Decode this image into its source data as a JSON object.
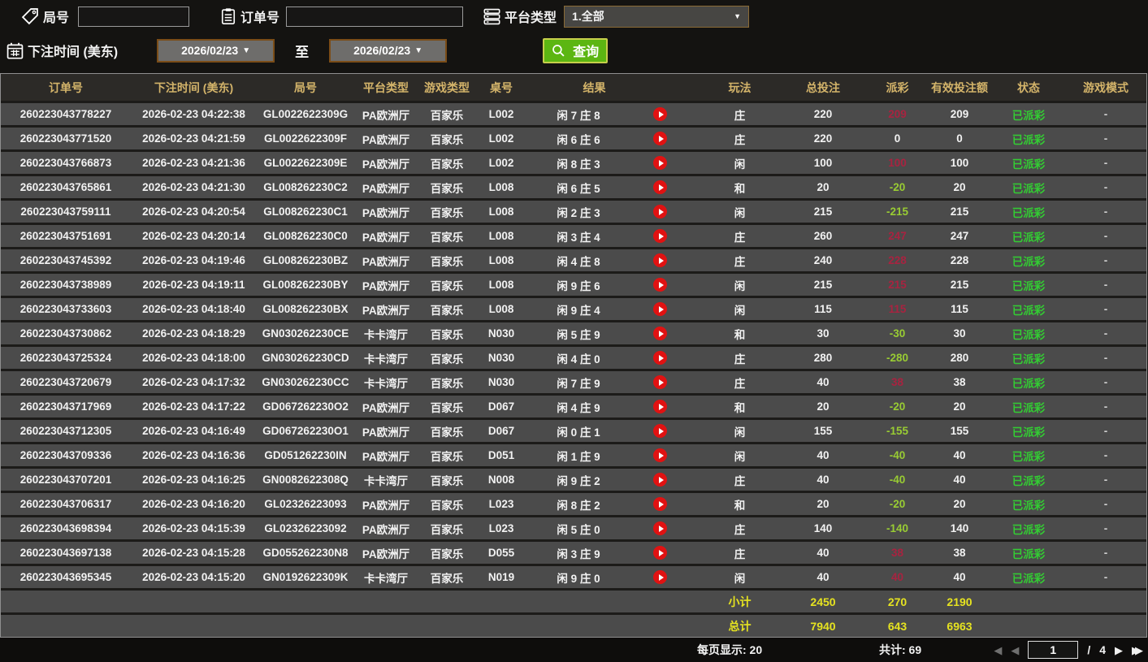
{
  "filters": {
    "round_label": "局号",
    "round_value": "",
    "order_label": "订单号",
    "order_value": "",
    "platform_label": "平台类型",
    "platform_selected": "1.全部",
    "bet_time_label": "下注时间 (美东)",
    "date_from": "2026/02/23",
    "date_to": "2026/02/23",
    "to_label": "至",
    "query_label": "查询"
  },
  "table": {
    "headers": [
      "订单号",
      "下注时间 (美东)",
      "局号",
      "平台类型",
      "游戏类型",
      "桌号",
      "结果",
      "玩法",
      "总投注",
      "派彩",
      "有效投注额",
      "状态",
      "游戏模式"
    ],
    "rows": [
      {
        "order_id": "260223043778227",
        "bet_time": "2026-02-23 04:22:38",
        "round_id": "GL0022622309G",
        "platform": "PA欧洲厅",
        "game_type": "百家乐",
        "table_no": "L002",
        "result": "闲 7 庄 8",
        "play_type": "庄",
        "total_bet": "220",
        "payout": "209",
        "payout_color": "red",
        "valid_bet": "209",
        "status": "已派彩",
        "game_mode": "-"
      },
      {
        "order_id": "260223043771520",
        "bet_time": "2026-02-23 04:21:59",
        "round_id": "GL0022622309F",
        "platform": "PA欧洲厅",
        "game_type": "百家乐",
        "table_no": "L002",
        "result": "闲 6 庄 6",
        "play_type": "庄",
        "total_bet": "220",
        "payout": "0",
        "payout_color": "white",
        "valid_bet": "0",
        "status": "已派彩",
        "game_mode": "-"
      },
      {
        "order_id": "260223043766873",
        "bet_time": "2026-02-23 04:21:36",
        "round_id": "GL0022622309E",
        "platform": "PA欧洲厅",
        "game_type": "百家乐",
        "table_no": "L002",
        "result": "闲 8 庄 3",
        "play_type": "闲",
        "total_bet": "100",
        "payout": "100",
        "payout_color": "red",
        "valid_bet": "100",
        "status": "已派彩",
        "game_mode": "-"
      },
      {
        "order_id": "260223043765861",
        "bet_time": "2026-02-23 04:21:30",
        "round_id": "GL008262230C2",
        "platform": "PA欧洲厅",
        "game_type": "百家乐",
        "table_no": "L008",
        "result": "闲 6 庄 5",
        "play_type": "和",
        "total_bet": "20",
        "payout": "-20",
        "payout_color": "green",
        "valid_bet": "20",
        "status": "已派彩",
        "game_mode": "-"
      },
      {
        "order_id": "260223043759111",
        "bet_time": "2026-02-23 04:20:54",
        "round_id": "GL008262230C1",
        "platform": "PA欧洲厅",
        "game_type": "百家乐",
        "table_no": "L008",
        "result": "闲 2 庄 3",
        "play_type": "闲",
        "total_bet": "215",
        "payout": "-215",
        "payout_color": "green",
        "valid_bet": "215",
        "status": "已派彩",
        "game_mode": "-"
      },
      {
        "order_id": "260223043751691",
        "bet_time": "2026-02-23 04:20:14",
        "round_id": "GL008262230C0",
        "platform": "PA欧洲厅",
        "game_type": "百家乐",
        "table_no": "L008",
        "result": "闲 3 庄 4",
        "play_type": "庄",
        "total_bet": "260",
        "payout": "247",
        "payout_color": "red",
        "valid_bet": "247",
        "status": "已派彩",
        "game_mode": "-"
      },
      {
        "order_id": "260223043745392",
        "bet_time": "2026-02-23 04:19:46",
        "round_id": "GL008262230BZ",
        "platform": "PA欧洲厅",
        "game_type": "百家乐",
        "table_no": "L008",
        "result": "闲 4 庄 8",
        "play_type": "庄",
        "total_bet": "240",
        "payout": "228",
        "payout_color": "red",
        "valid_bet": "228",
        "status": "已派彩",
        "game_mode": "-"
      },
      {
        "order_id": "260223043738989",
        "bet_time": "2026-02-23 04:19:11",
        "round_id": "GL008262230BY",
        "platform": "PA欧洲厅",
        "game_type": "百家乐",
        "table_no": "L008",
        "result": "闲 9 庄 6",
        "play_type": "闲",
        "total_bet": "215",
        "payout": "215",
        "payout_color": "red",
        "valid_bet": "215",
        "status": "已派彩",
        "game_mode": "-"
      },
      {
        "order_id": "260223043733603",
        "bet_time": "2026-02-23 04:18:40",
        "round_id": "GL008262230BX",
        "platform": "PA欧洲厅",
        "game_type": "百家乐",
        "table_no": "L008",
        "result": "闲 9 庄 4",
        "play_type": "闲",
        "total_bet": "115",
        "payout": "115",
        "payout_color": "red",
        "valid_bet": "115",
        "status": "已派彩",
        "game_mode": "-"
      },
      {
        "order_id": "260223043730862",
        "bet_time": "2026-02-23 04:18:29",
        "round_id": "GN030262230CE",
        "platform": "卡卡湾厅",
        "game_type": "百家乐",
        "table_no": "N030",
        "result": "闲 5 庄 9",
        "play_type": "和",
        "total_bet": "30",
        "payout": "-30",
        "payout_color": "green",
        "valid_bet": "30",
        "status": "已派彩",
        "game_mode": "-"
      },
      {
        "order_id": "260223043725324",
        "bet_time": "2026-02-23 04:18:00",
        "round_id": "GN030262230CD",
        "platform": "卡卡湾厅",
        "game_type": "百家乐",
        "table_no": "N030",
        "result": "闲 4 庄 0",
        "play_type": "庄",
        "total_bet": "280",
        "payout": "-280",
        "payout_color": "green",
        "valid_bet": "280",
        "status": "已派彩",
        "game_mode": "-"
      },
      {
        "order_id": "260223043720679",
        "bet_time": "2026-02-23 04:17:32",
        "round_id": "GN030262230CC",
        "platform": "卡卡湾厅",
        "game_type": "百家乐",
        "table_no": "N030",
        "result": "闲 7 庄 9",
        "play_type": "庄",
        "total_bet": "40",
        "payout": "38",
        "payout_color": "red",
        "valid_bet": "38",
        "status": "已派彩",
        "game_mode": "-"
      },
      {
        "order_id": "260223043717969",
        "bet_time": "2026-02-23 04:17:22",
        "round_id": "GD067262230O2",
        "platform": "PA欧洲厅",
        "game_type": "百家乐",
        "table_no": "D067",
        "result": "闲 4 庄 9",
        "play_type": "和",
        "total_bet": "20",
        "payout": "-20",
        "payout_color": "green",
        "valid_bet": "20",
        "status": "已派彩",
        "game_mode": "-"
      },
      {
        "order_id": "260223043712305",
        "bet_time": "2026-02-23 04:16:49",
        "round_id": "GD067262230O1",
        "platform": "PA欧洲厅",
        "game_type": "百家乐",
        "table_no": "D067",
        "result": "闲 0 庄 1",
        "play_type": "闲",
        "total_bet": "155",
        "payout": "-155",
        "payout_color": "green",
        "valid_bet": "155",
        "status": "已派彩",
        "game_mode": "-"
      },
      {
        "order_id": "260223043709336",
        "bet_time": "2026-02-23 04:16:36",
        "round_id": "GD051262230IN",
        "platform": "PA欧洲厅",
        "game_type": "百家乐",
        "table_no": "D051",
        "result": "闲 1 庄 9",
        "play_type": "闲",
        "total_bet": "40",
        "payout": "-40",
        "payout_color": "green",
        "valid_bet": "40",
        "status": "已派彩",
        "game_mode": "-"
      },
      {
        "order_id": "260223043707201",
        "bet_time": "2026-02-23 04:16:25",
        "round_id": "GN0082622308Q",
        "platform": "卡卡湾厅",
        "game_type": "百家乐",
        "table_no": "N008",
        "result": "闲 9 庄 2",
        "play_type": "庄",
        "total_bet": "40",
        "payout": "-40",
        "payout_color": "green",
        "valid_bet": "40",
        "status": "已派彩",
        "game_mode": "-"
      },
      {
        "order_id": "260223043706317",
        "bet_time": "2026-02-23 04:16:20",
        "round_id": "GL02326223093",
        "platform": "PA欧洲厅",
        "game_type": "百家乐",
        "table_no": "L023",
        "result": "闲 8 庄 2",
        "play_type": "和",
        "total_bet": "20",
        "payout": "-20",
        "payout_color": "green",
        "valid_bet": "20",
        "status": "已派彩",
        "game_mode": "-"
      },
      {
        "order_id": "260223043698394",
        "bet_time": "2026-02-23 04:15:39",
        "round_id": "GL02326223092",
        "platform": "PA欧洲厅",
        "game_type": "百家乐",
        "table_no": "L023",
        "result": "闲 5 庄 0",
        "play_type": "庄",
        "total_bet": "140",
        "payout": "-140",
        "payout_color": "green",
        "valid_bet": "140",
        "status": "已派彩",
        "game_mode": "-"
      },
      {
        "order_id": "260223043697138",
        "bet_time": "2026-02-23 04:15:28",
        "round_id": "GD055262230N8",
        "platform": "PA欧洲厅",
        "game_type": "百家乐",
        "table_no": "D055",
        "result": "闲 3 庄 9",
        "play_type": "庄",
        "total_bet": "40",
        "payout": "38",
        "payout_color": "red",
        "valid_bet": "38",
        "status": "已派彩",
        "game_mode": "-"
      },
      {
        "order_id": "260223043695345",
        "bet_time": "2026-02-23 04:15:20",
        "round_id": "GN0192622309K",
        "platform": "卡卡湾厅",
        "game_type": "百家乐",
        "table_no": "N019",
        "result": "闲 9 庄 0",
        "play_type": "闲",
        "total_bet": "40",
        "payout": "40",
        "payout_color": "red",
        "valid_bet": "40",
        "status": "已派彩",
        "game_mode": "-"
      }
    ],
    "subtotal": {
      "label": "小计",
      "total_bet": "2450",
      "payout": "270",
      "valid_bet": "2190"
    },
    "grand_total": {
      "label": "总计",
      "total_bet": "7940",
      "payout": "643",
      "valid_bet": "6963"
    }
  },
  "footer": {
    "page_size_label": "每页显示: 20",
    "total_count_label": "共计: 69",
    "current_page": "1",
    "page_separator": "/",
    "total_pages": "4"
  },
  "colors": {
    "header_text": "#d4b46a",
    "payout_positive": "#a82340",
    "payout_negative": "#99cc33",
    "status_paid": "#33cc33",
    "totals": "#e6e320",
    "query_button": "#5cb612",
    "query_border": "#c7cf4b",
    "date_border": "#7b4d18",
    "play_icon": "#e01212"
  }
}
